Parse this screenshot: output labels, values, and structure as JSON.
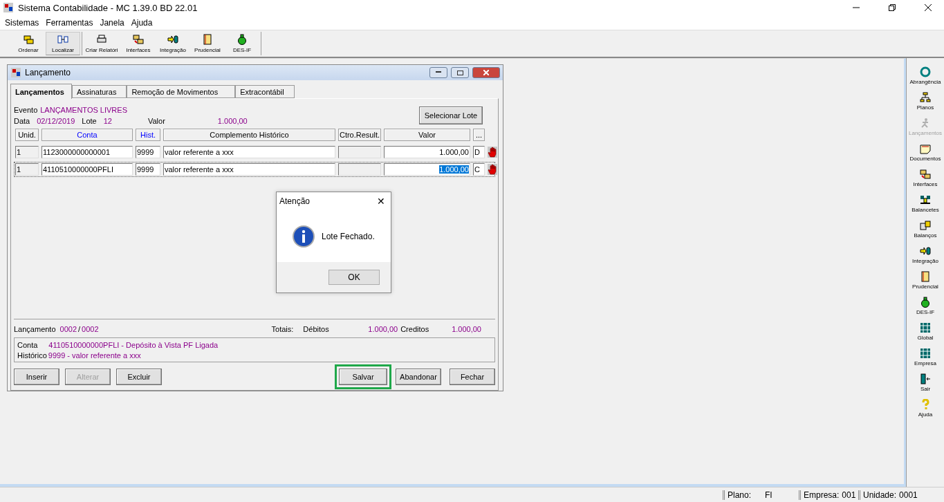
{
  "window": {
    "title": "Sistema Contabilidade -  MC 1.39.0 BD 22.01"
  },
  "menu": [
    "Sistemas",
    "Ferramentas",
    "Janela",
    "Ajuda"
  ],
  "toolbar": [
    {
      "label": "Ordenar",
      "selected": false,
      "kind": "folders"
    },
    {
      "label": "Localizar",
      "selected": true,
      "kind": "link"
    },
    {
      "label": "Criar Relatóri",
      "selected": false,
      "kind": "printer"
    },
    {
      "label": "Interfaces",
      "selected": false,
      "kind": "exchange"
    },
    {
      "label": "Integração",
      "selected": false,
      "kind": "integrate"
    },
    {
      "label": "Prudencial",
      "selected": false,
      "kind": "ledger"
    },
    {
      "label": "DES-IF",
      "selected": false,
      "kind": "money"
    }
  ],
  "child_window": {
    "title": "Lançamento",
    "tabs": [
      {
        "label": "Lançamentos",
        "selected": true
      },
      {
        "label": "Assinaturas",
        "selected": false
      },
      {
        "label": "Remoção de Movimentos",
        "selected": false
      },
      {
        "label": "Extracontábil",
        "selected": false
      }
    ],
    "evento": {
      "label": "Evento",
      "value": "LANÇAMENTOS LIVRES"
    },
    "data": {
      "label": "Data",
      "value": "02/12/2019"
    },
    "lote": {
      "label": "Lote",
      "value": "12"
    },
    "valor": {
      "label": "Valor",
      "value": "1.000,00"
    },
    "select_button": "Selecionar Lote",
    "columns": [
      {
        "label": "Unid.",
        "link": false
      },
      {
        "label": "Conta",
        "link": true
      },
      {
        "label": "Hist.",
        "link": true
      },
      {
        "label": "Complemento Histórico",
        "link": false
      },
      {
        "label": "Ctro.Result.",
        "link": false
      },
      {
        "label": "Valor",
        "link": false
      },
      {
        "label": "...",
        "link": false
      }
    ],
    "rows": [
      {
        "unid": "1",
        "conta": "1123000000000001",
        "hist": "9999",
        "complemento": "valor referente a xxx",
        "valor": "1.000,00",
        "dc": "D",
        "selected": false
      },
      {
        "unid": "1",
        "conta": "4110510000000PFLI",
        "hist": "9999",
        "complemento": "valor referente a xxx",
        "valor": "1.000,00",
        "dc": "C",
        "selected": true
      }
    ],
    "lancamento": {
      "label": "Lançamento",
      "current": "0002",
      "separator": "/",
      "total": "0002"
    },
    "totais": {
      "label": "Totais:",
      "debitos_label": "Débitos",
      "debitos": "1.000,00",
      "creditos_label": "Creditos",
      "creditos": "1.000,00"
    },
    "info": [
      {
        "label": "Conta",
        "value": "4110510000000PFLI - Depósito à Vista PF Ligada"
      },
      {
        "label": "Histórico",
        "value": "9999 - valor referente a xxx"
      }
    ],
    "buttons_left": [
      {
        "label": "Inserir",
        "disabled": false
      },
      {
        "label": "Alterar",
        "disabled": true
      },
      {
        "label": "Excluir",
        "disabled": false
      }
    ],
    "buttons_right": [
      {
        "label": "Salvar",
        "highlighted": true
      },
      {
        "label": "Abandonar",
        "highlighted": false
      },
      {
        "label": "Fechar",
        "highlighted": false
      }
    ]
  },
  "dialog": {
    "title": "Atenção",
    "close": "✕",
    "message": "Lote Fechado.",
    "button": "OK"
  },
  "sidebar": [
    {
      "label": "Abrangência",
      "kind": "cycle",
      "disabled": false
    },
    {
      "label": "Planos",
      "kind": "tree",
      "disabled": false
    },
    {
      "label": "Lançamentos",
      "kind": "runner",
      "disabled": true
    },
    {
      "label": "Documentos",
      "kind": "document",
      "disabled": false
    },
    {
      "label": "Interfaces",
      "kind": "exchange",
      "disabled": false
    },
    {
      "label": "Balancetes",
      "kind": "scale",
      "disabled": false
    },
    {
      "label": "Balanços",
      "kind": "building",
      "disabled": false
    },
    {
      "label": "Integração",
      "kind": "integrate",
      "disabled": false
    },
    {
      "label": "Prudencial",
      "kind": "ledger",
      "disabled": false
    },
    {
      "label": "DES-IF",
      "kind": "money",
      "disabled": false
    },
    {
      "label": "Global",
      "kind": "grid",
      "disabled": false
    },
    {
      "label": "Empresa",
      "kind": "grid",
      "disabled": false
    },
    {
      "label": "Sair",
      "kind": "door",
      "disabled": false
    },
    {
      "label": "Ajuda",
      "kind": "question",
      "disabled": false
    }
  ],
  "status_bar": [
    {
      "label": "Plano:",
      "value": "FI"
    },
    {
      "label": "Empresa:",
      "value": "001"
    },
    {
      "label": "Unidade:",
      "value": "0001"
    }
  ]
}
